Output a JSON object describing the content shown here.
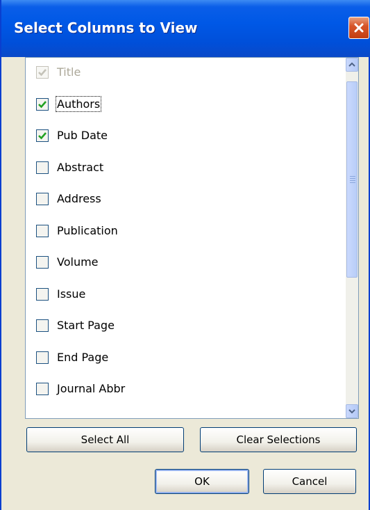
{
  "window": {
    "title": "Select Columns to View"
  },
  "columns": [
    {
      "label": "Title",
      "checked": true,
      "disabled": true
    },
    {
      "label": "Authors",
      "checked": true,
      "focused": true
    },
    {
      "label": "Pub Date",
      "checked": true
    },
    {
      "label": "Abstract",
      "checked": false
    },
    {
      "label": "Address",
      "checked": false
    },
    {
      "label": "Publication",
      "checked": false
    },
    {
      "label": "Volume",
      "checked": false
    },
    {
      "label": "Issue",
      "checked": false
    },
    {
      "label": "Start Page",
      "checked": false
    },
    {
      "label": "End Page",
      "checked": false
    },
    {
      "label": "Journal Abbr",
      "checked": false
    }
  ],
  "buttons": {
    "select_all": "Select All",
    "clear_selections": "Clear Selections",
    "ok": "OK",
    "cancel": "Cancel"
  },
  "colors": {
    "title_bar": "#0058e6",
    "close_button": "#d8562a",
    "check_mark": "#21a121",
    "dialog_background": "#ece9d8"
  }
}
